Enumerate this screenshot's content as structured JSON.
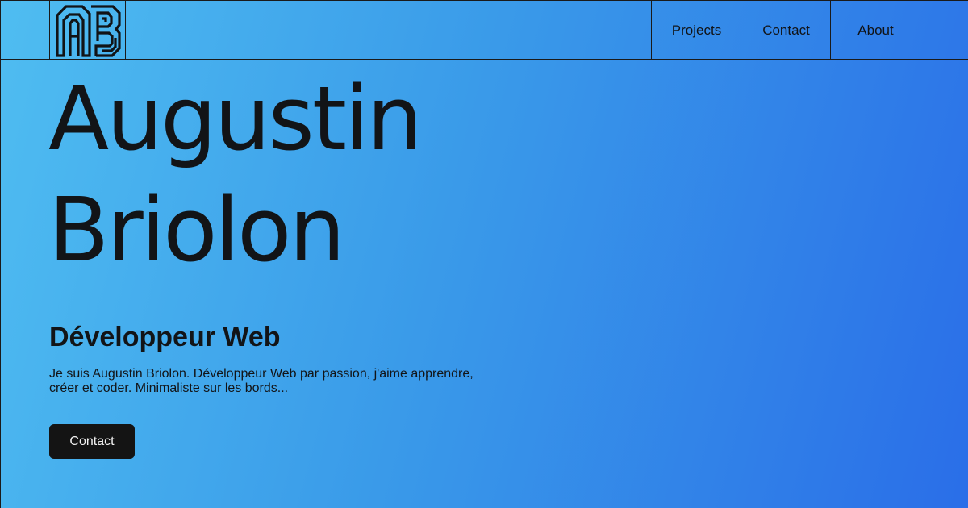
{
  "nav": {
    "items": [
      {
        "label": "Projects"
      },
      {
        "label": "Contact"
      },
      {
        "label": "About"
      }
    ]
  },
  "logo": {
    "icon": "ab-monogram-icon"
  },
  "hero": {
    "name_line1": "Augustin",
    "name_line2": "Briolon",
    "subtitle": "Développeur Web",
    "bio": "Je suis Augustin Briolon. Développeur Web par passion, j'aime apprendre, créer et coder. Minimaliste sur les bords...",
    "cta_label": "Contact"
  },
  "colors": {
    "gradient_start": "#4fbdf1",
    "gradient_end": "#2a6ee8",
    "text": "#121417",
    "button_bg": "#141414",
    "button_text": "#f2f2f2"
  }
}
